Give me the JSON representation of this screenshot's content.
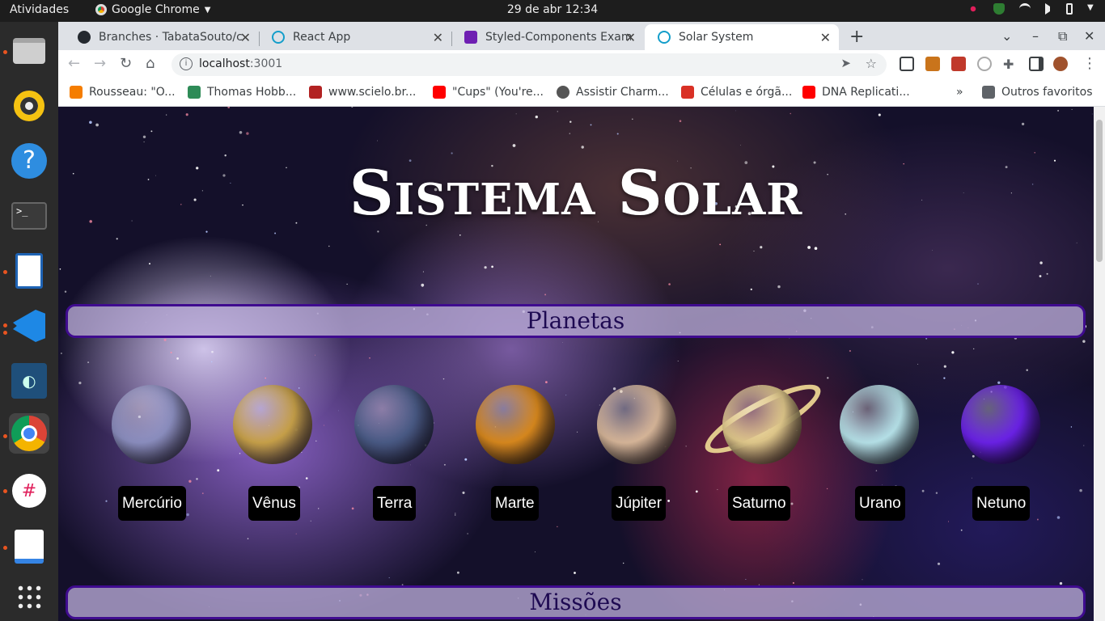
{
  "os": {
    "activities": "Atividades",
    "app_name": "Google Chrome",
    "clock": "29 de abr  12:34"
  },
  "browser": {
    "tabs": [
      {
        "title": "Branches · TabataSouto/c",
        "favicon": "github-icon",
        "color": "#24292f"
      },
      {
        "title": "React App",
        "favicon": "react-icon",
        "color": "#61dafb"
      },
      {
        "title": "Styled-Components Exam",
        "favicon": "styled-components-icon",
        "color": "#6f1fb2"
      },
      {
        "title": "Solar System",
        "favicon": "react-icon",
        "color": "#61dafb",
        "active": true
      }
    ],
    "url_host": "localhost",
    "url_port": ":3001",
    "bookmarks": [
      {
        "label": "Rousseau: \"O...",
        "color": "#f57d00"
      },
      {
        "label": "Thomas Hobb...",
        "color": "#2e8b57"
      },
      {
        "label": "www.scielo.br...",
        "color": "#b22222"
      },
      {
        "label": "\"Cups\" (You're...",
        "color": "#ff0000"
      },
      {
        "label": "Assistir Charm...",
        "color": "#555555"
      },
      {
        "label": "Células e órgã...",
        "color": "#d93025"
      },
      {
        "label": "DNA Replicati...",
        "color": "#ff0000"
      }
    ],
    "more_bookmarks": "»",
    "other_bookmarks": "Outros favoritos"
  },
  "page": {
    "title": "Sistema Solar",
    "sections": {
      "planets": "Planetas",
      "missions": "Missões"
    },
    "planets": [
      {
        "name": "Mercúrio",
        "color": "#8c8fc0"
      },
      {
        "name": "Vênus",
        "color": "#c9a24a"
      },
      {
        "name": "Terra",
        "color": "#4a5b86"
      },
      {
        "name": "Marte",
        "color": "#d9891e"
      },
      {
        "name": "Júpiter",
        "color": "#d8b79a"
      },
      {
        "name": "Saturno",
        "color": "#e1c98c"
      },
      {
        "name": "Urano",
        "color": "#b7e3ea"
      },
      {
        "name": "Netuno",
        "color": "#6b22e8"
      }
    ]
  }
}
